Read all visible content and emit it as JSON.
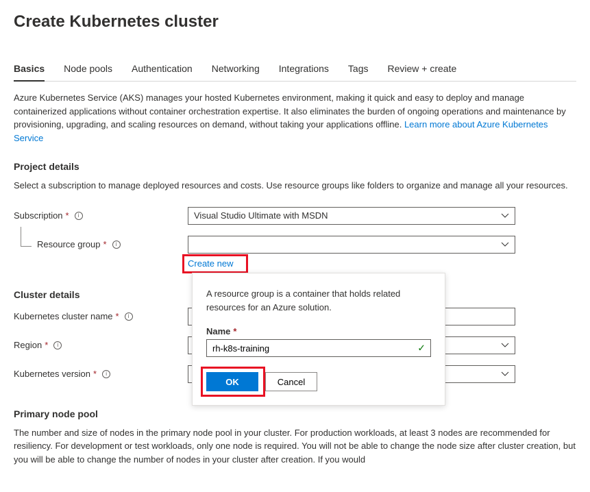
{
  "page": {
    "title": "Create Kubernetes cluster"
  },
  "tabs": [
    {
      "label": "Basics",
      "active": true
    },
    {
      "label": "Node pools"
    },
    {
      "label": "Authentication"
    },
    {
      "label": "Networking"
    },
    {
      "label": "Integrations"
    },
    {
      "label": "Tags"
    },
    {
      "label": "Review + create"
    }
  ],
  "intro": {
    "text": "Azure Kubernetes Service (AKS) manages your hosted Kubernetes environment, making it quick and easy to deploy and manage containerized applications without container orchestration expertise. It also eliminates the burden of ongoing operations and maintenance by provisioning, upgrading, and scaling resources on demand, without taking your applications offline.  ",
    "link": "Learn more about Azure Kubernetes Service"
  },
  "project_details": {
    "heading": "Project details",
    "desc": "Select a subscription to manage deployed resources and costs. Use resource groups like folders to organize and manage all your resources.",
    "subscription_label": "Subscription",
    "subscription_value": "Visual Studio Ultimate with MSDN",
    "resource_group_label": "Resource group",
    "resource_group_value": "",
    "create_new": "Create new"
  },
  "cluster_details": {
    "heading": "Cluster details",
    "name_label": "Kubernetes cluster name",
    "region_label": "Region",
    "version_label": "Kubernetes version"
  },
  "primary_pool": {
    "heading": "Primary node pool",
    "desc": "The number and size of nodes in the primary node pool in your cluster. For production workloads, at least 3 nodes are recommended for resiliency. For development or test workloads, only one node is required. You will not be able to change the node size after cluster creation, but you will be able to change the number of nodes in your cluster after creation. If you would"
  },
  "popover": {
    "desc": "A resource group is a container that holds related resources for an Azure solution.",
    "name_label": "Name",
    "name_value": "rh-k8s-training",
    "ok": "OK",
    "cancel": "Cancel"
  }
}
